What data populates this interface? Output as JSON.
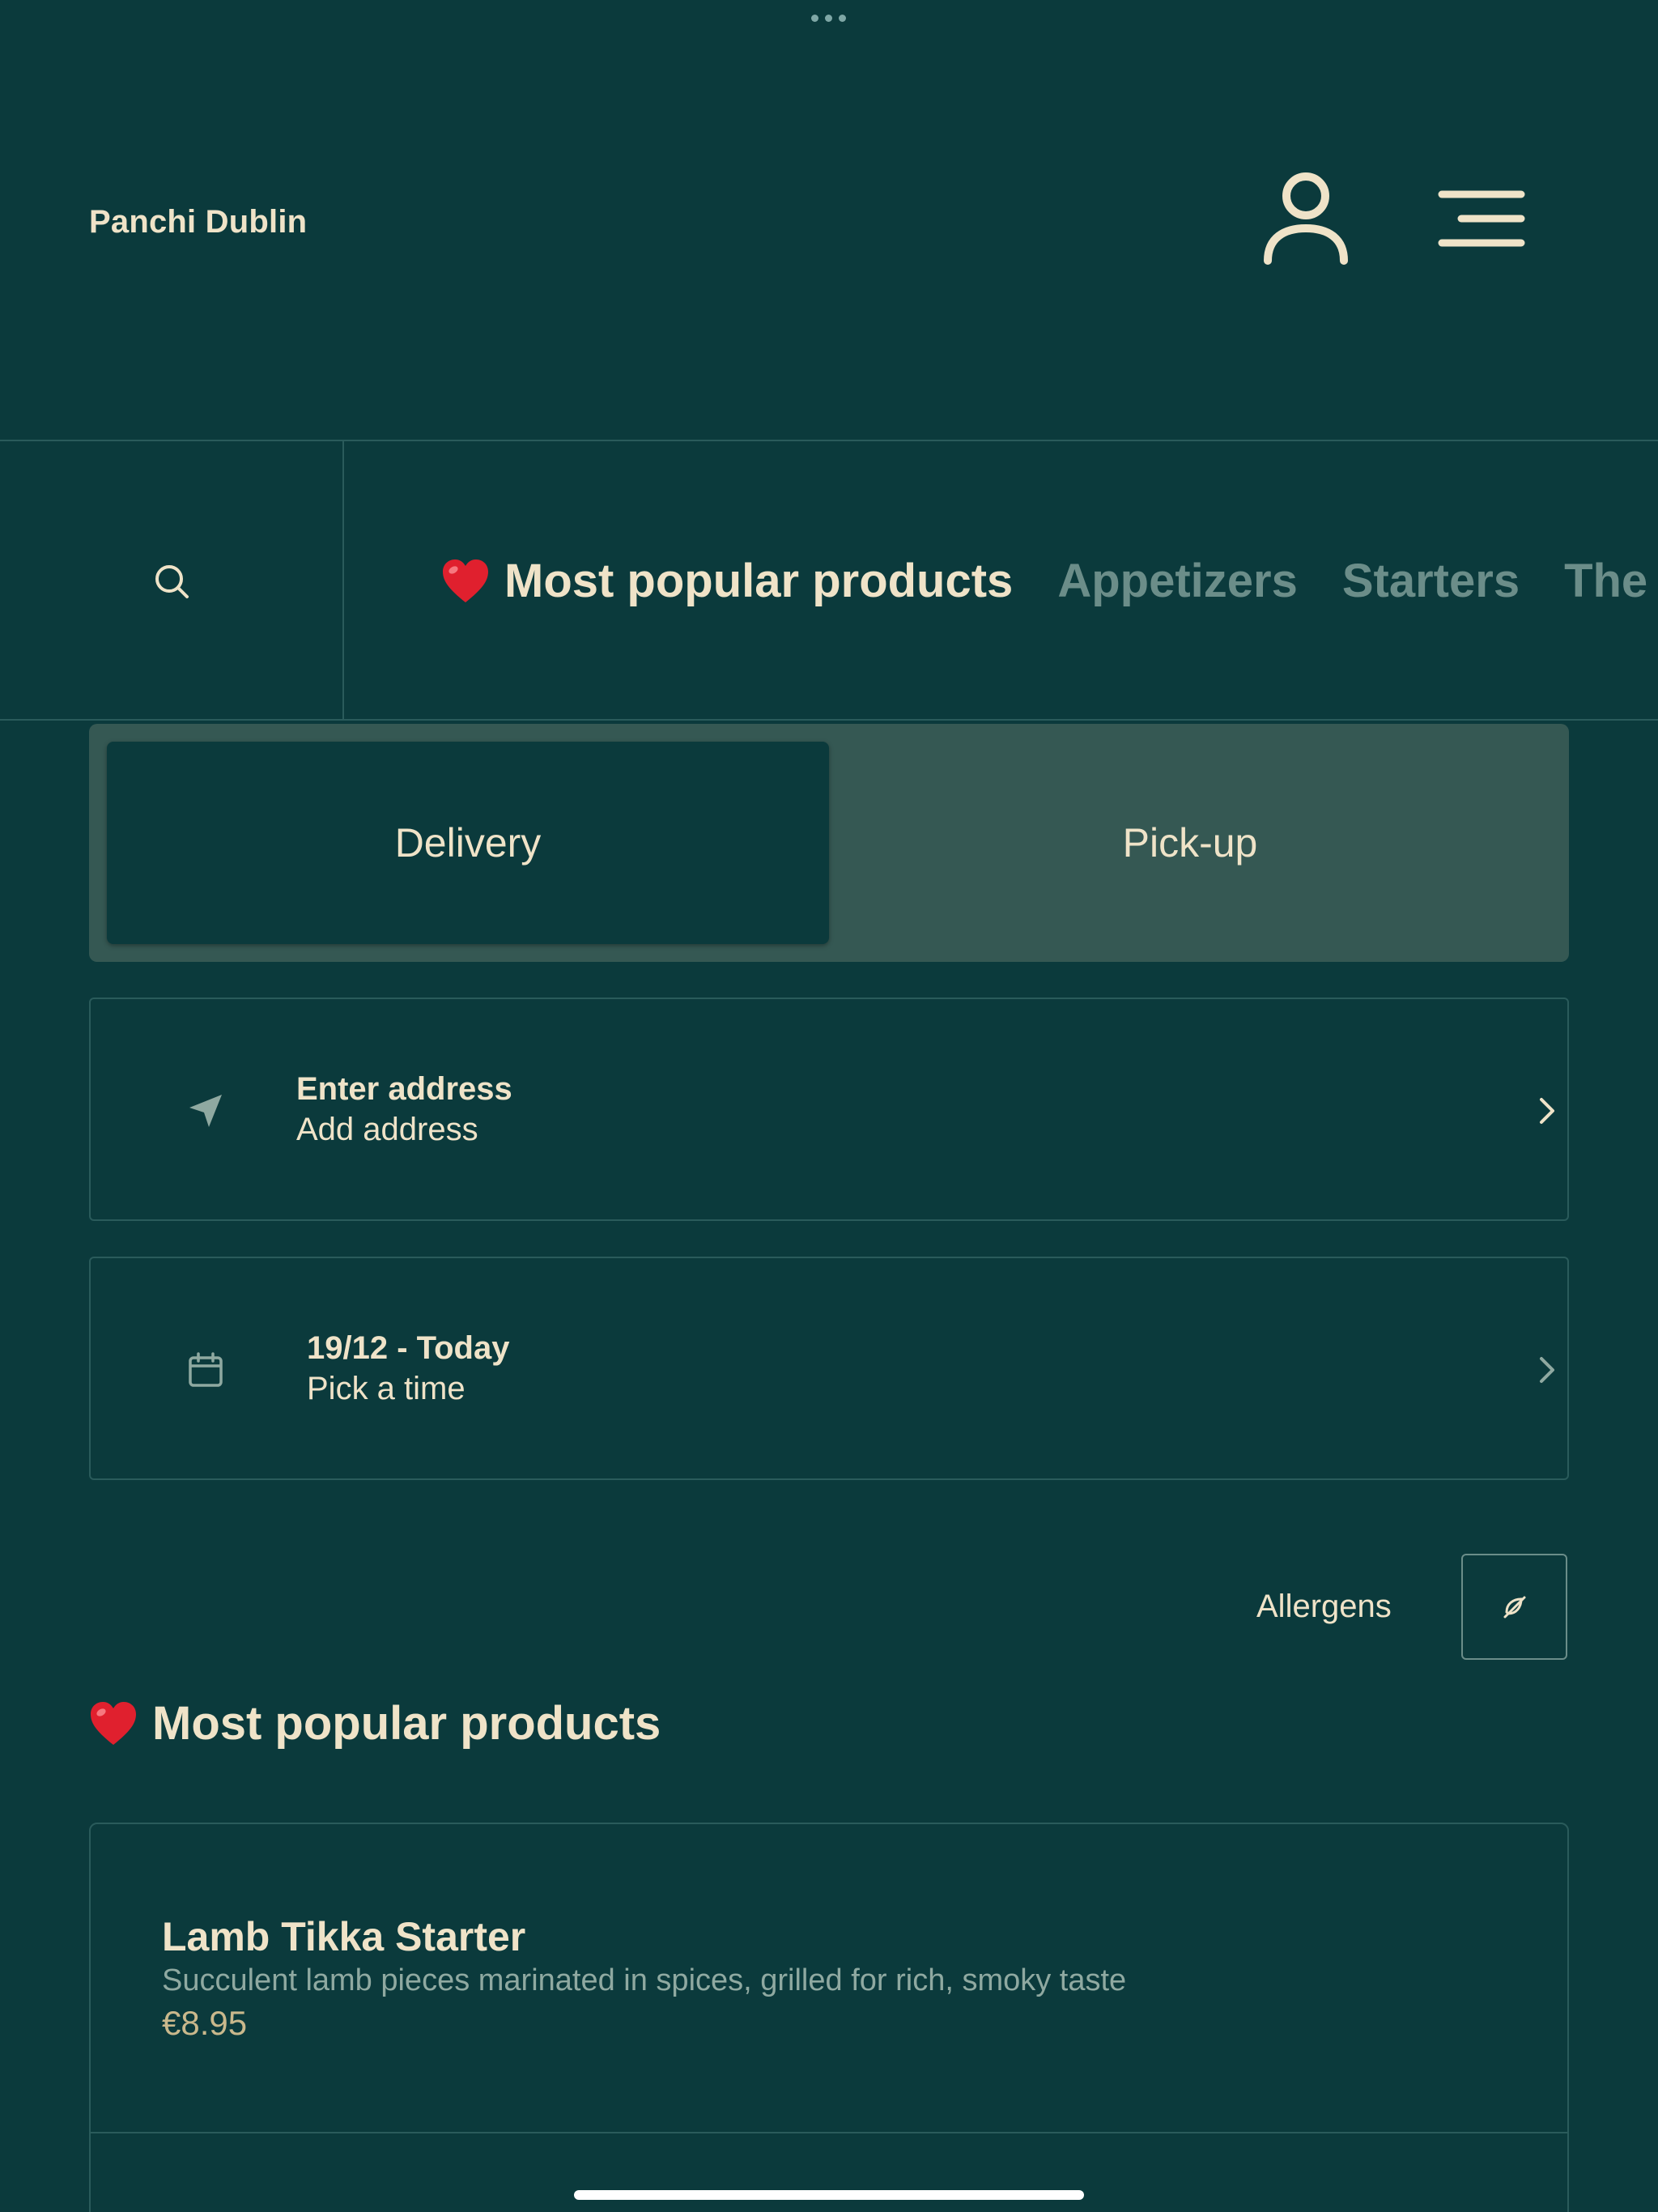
{
  "header": {
    "brand": "Panchi Dublin",
    "icons": {
      "user": "user-icon",
      "menu": "hamburger-menu-icon"
    }
  },
  "category_nav": {
    "search_icon": "search-icon",
    "tabs": [
      {
        "label": "Most popular products",
        "active": true,
        "emoji_icon": "heart-icon"
      },
      {
        "label": "Appetizers",
        "active": false
      },
      {
        "label": "Starters",
        "active": false
      },
      {
        "label": "The",
        "active": false
      }
    ]
  },
  "order_type": {
    "options": [
      "Delivery",
      "Pick-up"
    ],
    "selected": "Delivery"
  },
  "address": {
    "title": "Enter address",
    "subtitle": "Add address",
    "icon": "location-arrow-icon"
  },
  "schedule": {
    "title": "19/12 - Today",
    "subtitle": "Pick a time",
    "icon": "calendar-icon"
  },
  "allergens": {
    "label": "Allergens",
    "icon": "allergen-filter-icon"
  },
  "section": {
    "title": "Most popular products",
    "icon": "heart-icon"
  },
  "products": [
    {
      "name": "Lamb Tikka Starter",
      "description": "Succulent lamb pieces marinated in spices, grilled for rich, smoky taste",
      "price": "€8.95"
    }
  ],
  "colors": {
    "background": "#0b3a3c",
    "text": "#efe3c8",
    "muted": "#6b8d89",
    "toggle_bg": "#355853",
    "price": "#c9b88c",
    "heart": "#e0202e"
  }
}
